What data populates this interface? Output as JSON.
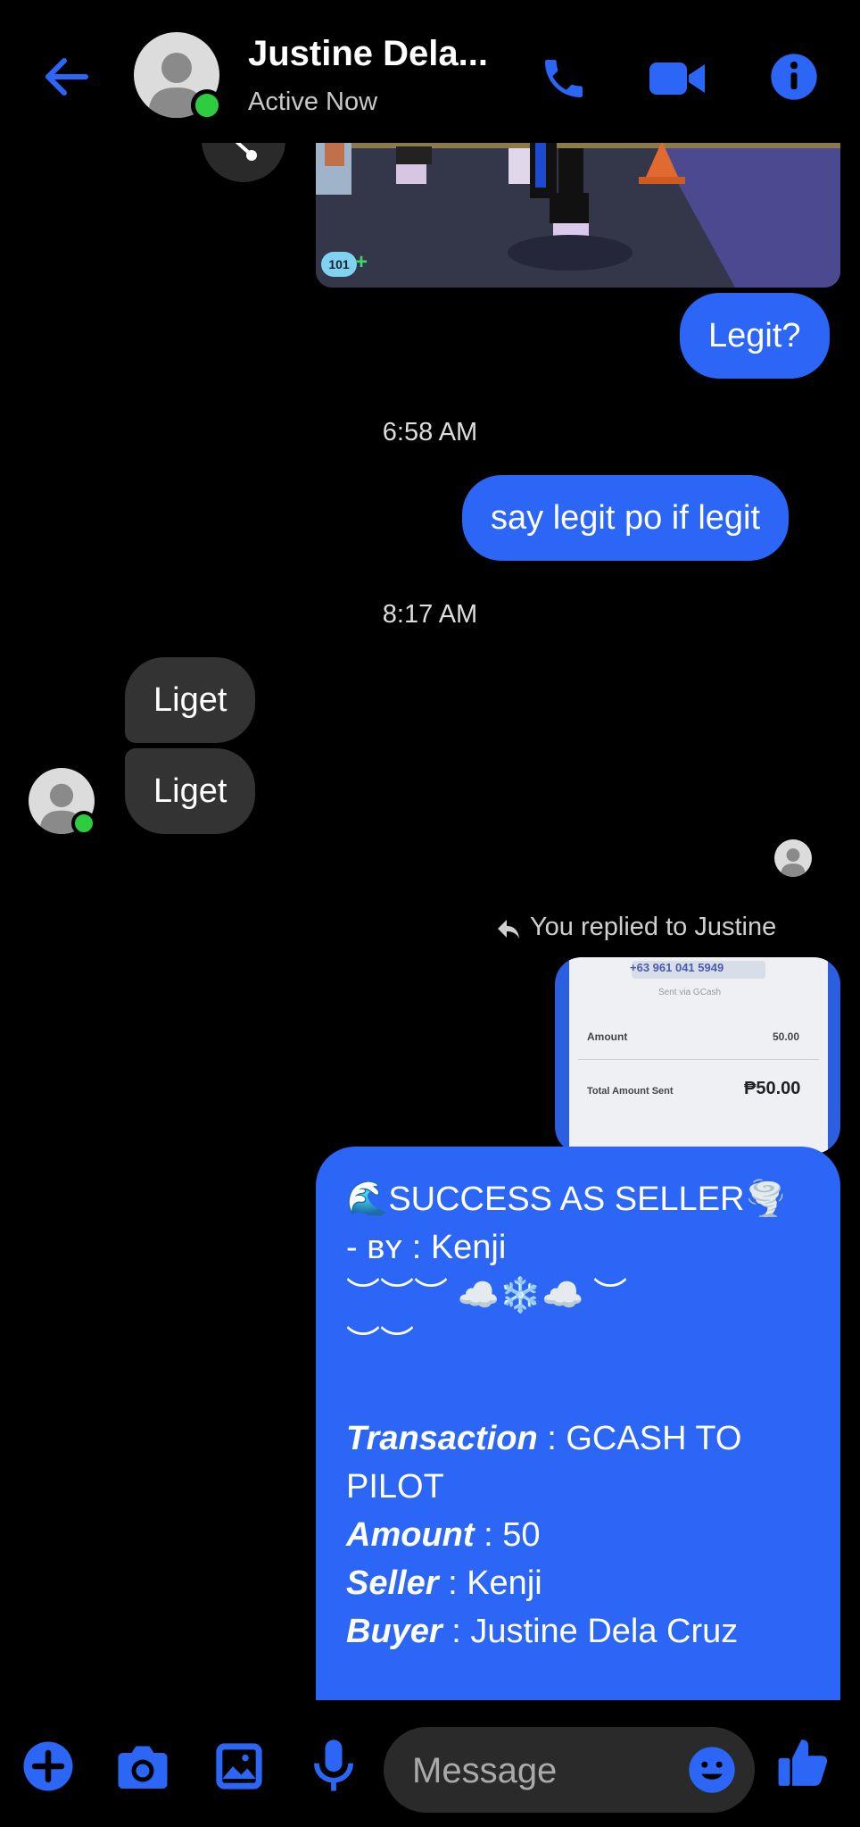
{
  "header": {
    "contact_name": "Justine Dela...",
    "status": "Active Now"
  },
  "game_image": {
    "badge": "101"
  },
  "messages": {
    "legit": "Legit?",
    "time1": "6:58 AM",
    "say_legit": "say legit po if legit",
    "time2": "8:17 AM",
    "liget1": "Liget",
    "liget2": "Liget",
    "replied_to": "You replied to Justine"
  },
  "receipt": {
    "phone": "+63 961 041 5949",
    "sent_via": "Sent via GCash",
    "amount_label": "Amount",
    "amount_value": "50.00",
    "total_label": "Total Amount Sent",
    "total_value": "₱50.00"
  },
  "success": {
    "line1": "🌊SUCCESS AS SELLER🌪️",
    "line2": "- ʙʏ : Kenji",
    "line3": "︶︶︶ ☁️❄️☁️ ︶",
    "line4": "︶︶",
    "transaction_label": "Transaction",
    "transaction_value": " : GCASH TO PILOT",
    "amount_label": "Amount",
    "amount_value": " : 50",
    "seller_label": "Seller",
    "seller_value": " : Kenji",
    "buyer_label": "Buyer",
    "buyer_value": " : Justine Dela Cruz"
  },
  "composer": {
    "placeholder": "Message"
  },
  "colors": {
    "accent": "#2c66f6",
    "incoming": "#333333",
    "online": "#2ecc40",
    "background": "#000000"
  }
}
